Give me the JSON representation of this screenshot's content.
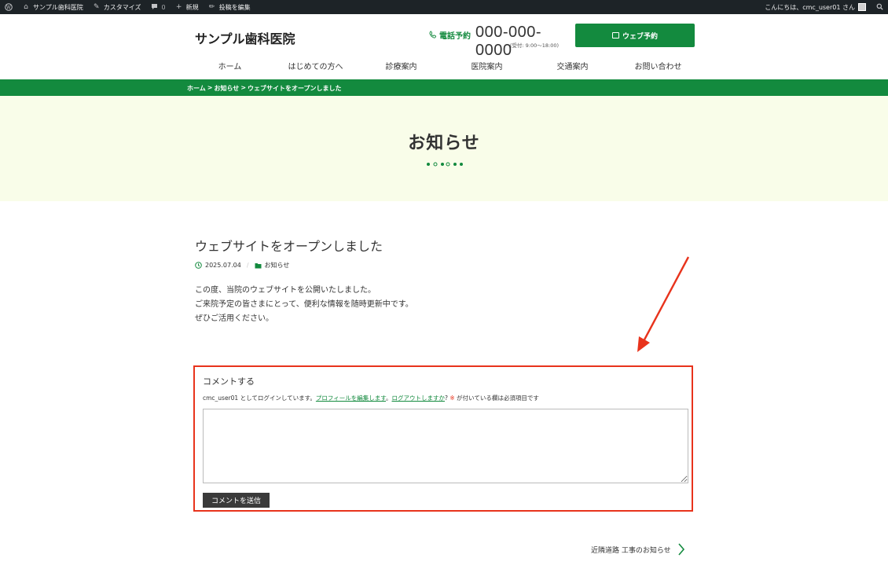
{
  "adminbar": {
    "site_name": "サンプル歯科医院",
    "customize": "カスタマイズ",
    "comments_count": "0",
    "new": "新規",
    "edit_post": "投稿を編集",
    "greeting": "こんにちは、cmc_user01 さん"
  },
  "header": {
    "site_title": "サンプル歯科医院",
    "phone_label": "電話予約",
    "phone_number": "000-000-0000",
    "phone_hours": "(受付: 9:00〜18:00)",
    "web_button": "ウェブ予約"
  },
  "nav": {
    "items": [
      "ホーム",
      "はじめての方へ",
      "診療案内",
      "医院案内",
      "交通案内",
      "お問い合わせ"
    ]
  },
  "breadcrumb": {
    "items": [
      "ホーム",
      "お知らせ",
      "ウェブサイトをオープンしました"
    ],
    "sep": ">"
  },
  "hero": {
    "title": "お知らせ"
  },
  "post": {
    "title": "ウェブサイトをオープンしました",
    "date": "2025.07.04",
    "category": "お知らせ",
    "body": [
      "この度、当院のウェブサイトを公開いたしました。",
      "ご来院予定の皆さまにとって、便利な情報を随時更新中です。",
      "ぜひご活用ください。"
    ]
  },
  "comment": {
    "title": "コメントする",
    "logged_in_prefix": "cmc_user01 としてログインしています。",
    "edit_profile": "プロフィールを編集します",
    "sep": "。",
    "logout": "ログアウトしますか",
    "q": "?",
    "required_mark": "※",
    "required_suffix": " が付いている欄は必須項目です",
    "textarea_value": "",
    "submit": "コメントを送信"
  },
  "next_post": {
    "label": "近隣道路 工事のお知らせ"
  },
  "colors": {
    "brand_green": "#138a3e",
    "hero_bg": "#f9fde9",
    "annotation_red": "#e8331c",
    "adminbar_bg": "#1d2327"
  }
}
